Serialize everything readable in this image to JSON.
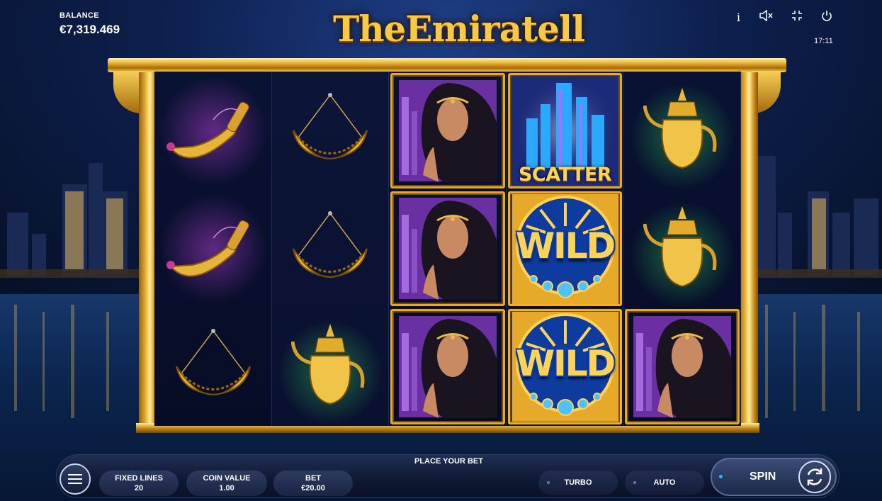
{
  "header": {
    "balance_label": "BALANCE",
    "balance_value": "€7,319.469",
    "logo_text": "TheEmiratell",
    "clock": "17:11",
    "icons": [
      "info-icon",
      "mute-icon",
      "fullscreen-exit-icon",
      "power-icon"
    ]
  },
  "reels": [
    [
      "dagger",
      "dagger",
      "necklace"
    ],
    [
      "necklace",
      "necklace",
      "teapot"
    ],
    [
      "woman",
      "woman",
      "woman"
    ],
    [
      "scatter",
      "wild",
      "wild"
    ],
    [
      "teapot",
      "teapot",
      "woman"
    ]
  ],
  "symbols": {
    "scatter_label": "SCATTER",
    "wild_label": "WILD"
  },
  "controls": {
    "place_bet": "PLACE YOUR BET",
    "fixed_lines_label": "FIXED LINES",
    "fixed_lines_value": "20",
    "coin_value_label": "COIN VALUE",
    "coin_value_value": "1.00",
    "bet_label": "BET",
    "bet_value": "€20.00",
    "turbo": "TURBO",
    "auto": "AUTO",
    "spin": "SPIN"
  },
  "colors": {
    "gold": "#f1c146",
    "accent_blue": "#29b6ff",
    "panel": "#0a1030"
  }
}
